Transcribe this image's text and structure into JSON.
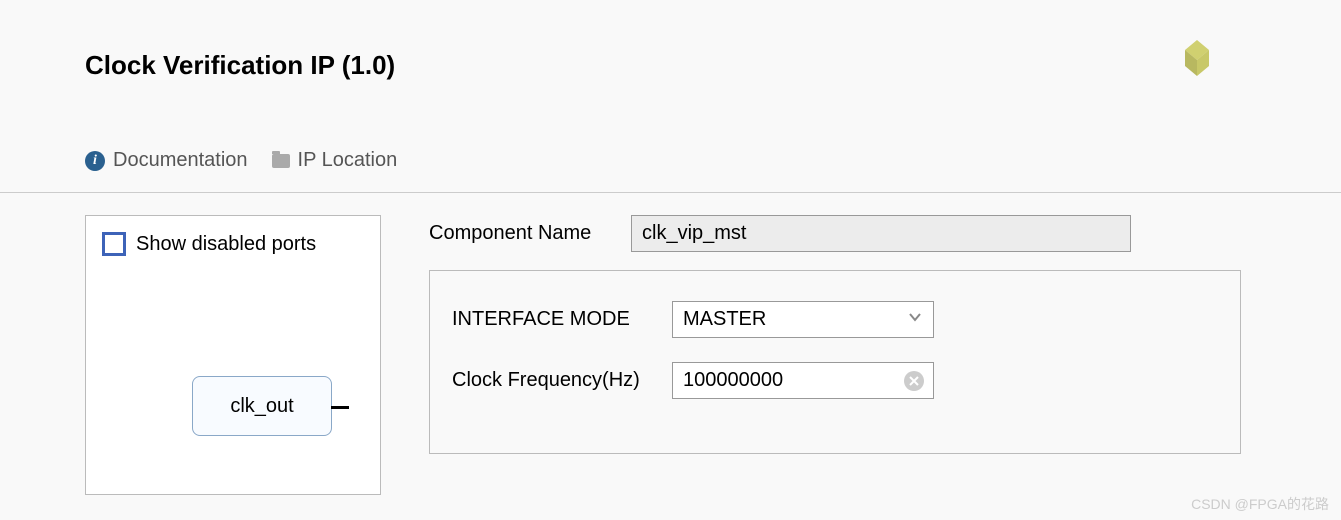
{
  "title": "Clock Verification IP (1.0)",
  "links": {
    "documentation": "Documentation",
    "ip_location": "IP Location"
  },
  "left_panel": {
    "show_disabled_ports": "Show disabled ports",
    "port_name": "clk_out"
  },
  "form": {
    "component_name_label": "Component Name",
    "component_name_value": "clk_vip_mst",
    "interface_mode_label": "INTERFACE MODE",
    "interface_mode_value": "MASTER",
    "clock_frequency_label": "Clock Frequency(Hz)",
    "clock_frequency_value": "100000000"
  },
  "watermark": "CSDN @FPGA的花路"
}
